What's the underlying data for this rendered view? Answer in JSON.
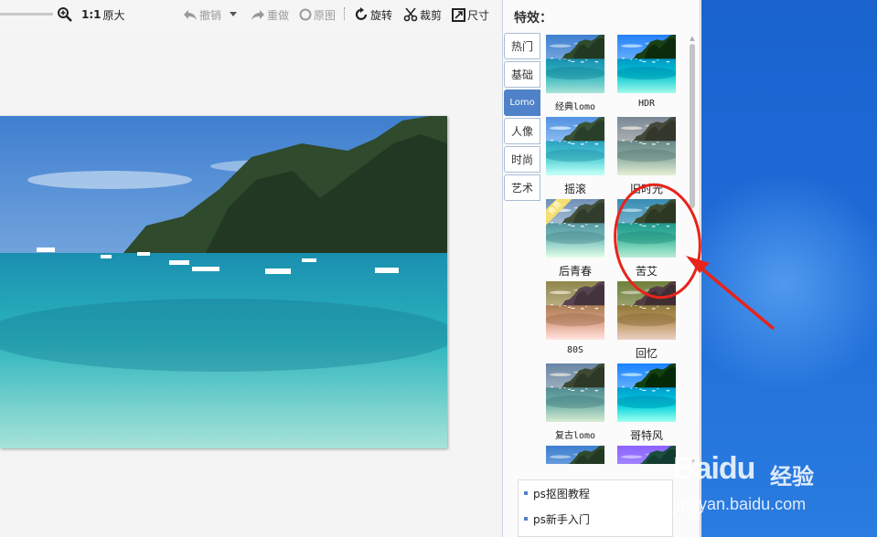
{
  "toolbar": {
    "ratio_label": "1:1",
    "original_size_label": "原大",
    "undo_label": "撤销",
    "redo_label": "重做",
    "original_label": "原图",
    "rotate_label": "旋转",
    "crop_label": "裁剪",
    "size_label": "尺寸"
  },
  "effects_panel": {
    "title": "特效：",
    "categories": [
      {
        "label": "热门",
        "active": false
      },
      {
        "label": "基础",
        "active": false
      },
      {
        "label": "Lomo",
        "active": true
      },
      {
        "label": "人像",
        "active": false
      },
      {
        "label": "时尚",
        "active": false
      },
      {
        "label": "艺术",
        "active": false
      }
    ],
    "effects": [
      {
        "label": "经典lomo",
        "badge": ""
      },
      {
        "label": "HDR",
        "badge": ""
      },
      {
        "label": "摇滚",
        "badge": ""
      },
      {
        "label": "旧时光",
        "badge": ""
      },
      {
        "label": "后青春",
        "badge": "会员"
      },
      {
        "label": "苦艾",
        "badge": ""
      },
      {
        "label": "80S",
        "badge": ""
      },
      {
        "label": "回忆",
        "badge": ""
      },
      {
        "label": "复古lomo",
        "badge": ""
      },
      {
        "label": "哥特风",
        "badge": ""
      }
    ],
    "links": [
      "ps抠图教程",
      "ps新手入门"
    ]
  },
  "watermark": {
    "logo": "Baidu",
    "cn": "经验",
    "url": "jingyan.baidu.com"
  },
  "colors": {
    "accent": "#4f82c8",
    "annotation": "#e8231b",
    "desktop": "#1d6ad6"
  }
}
